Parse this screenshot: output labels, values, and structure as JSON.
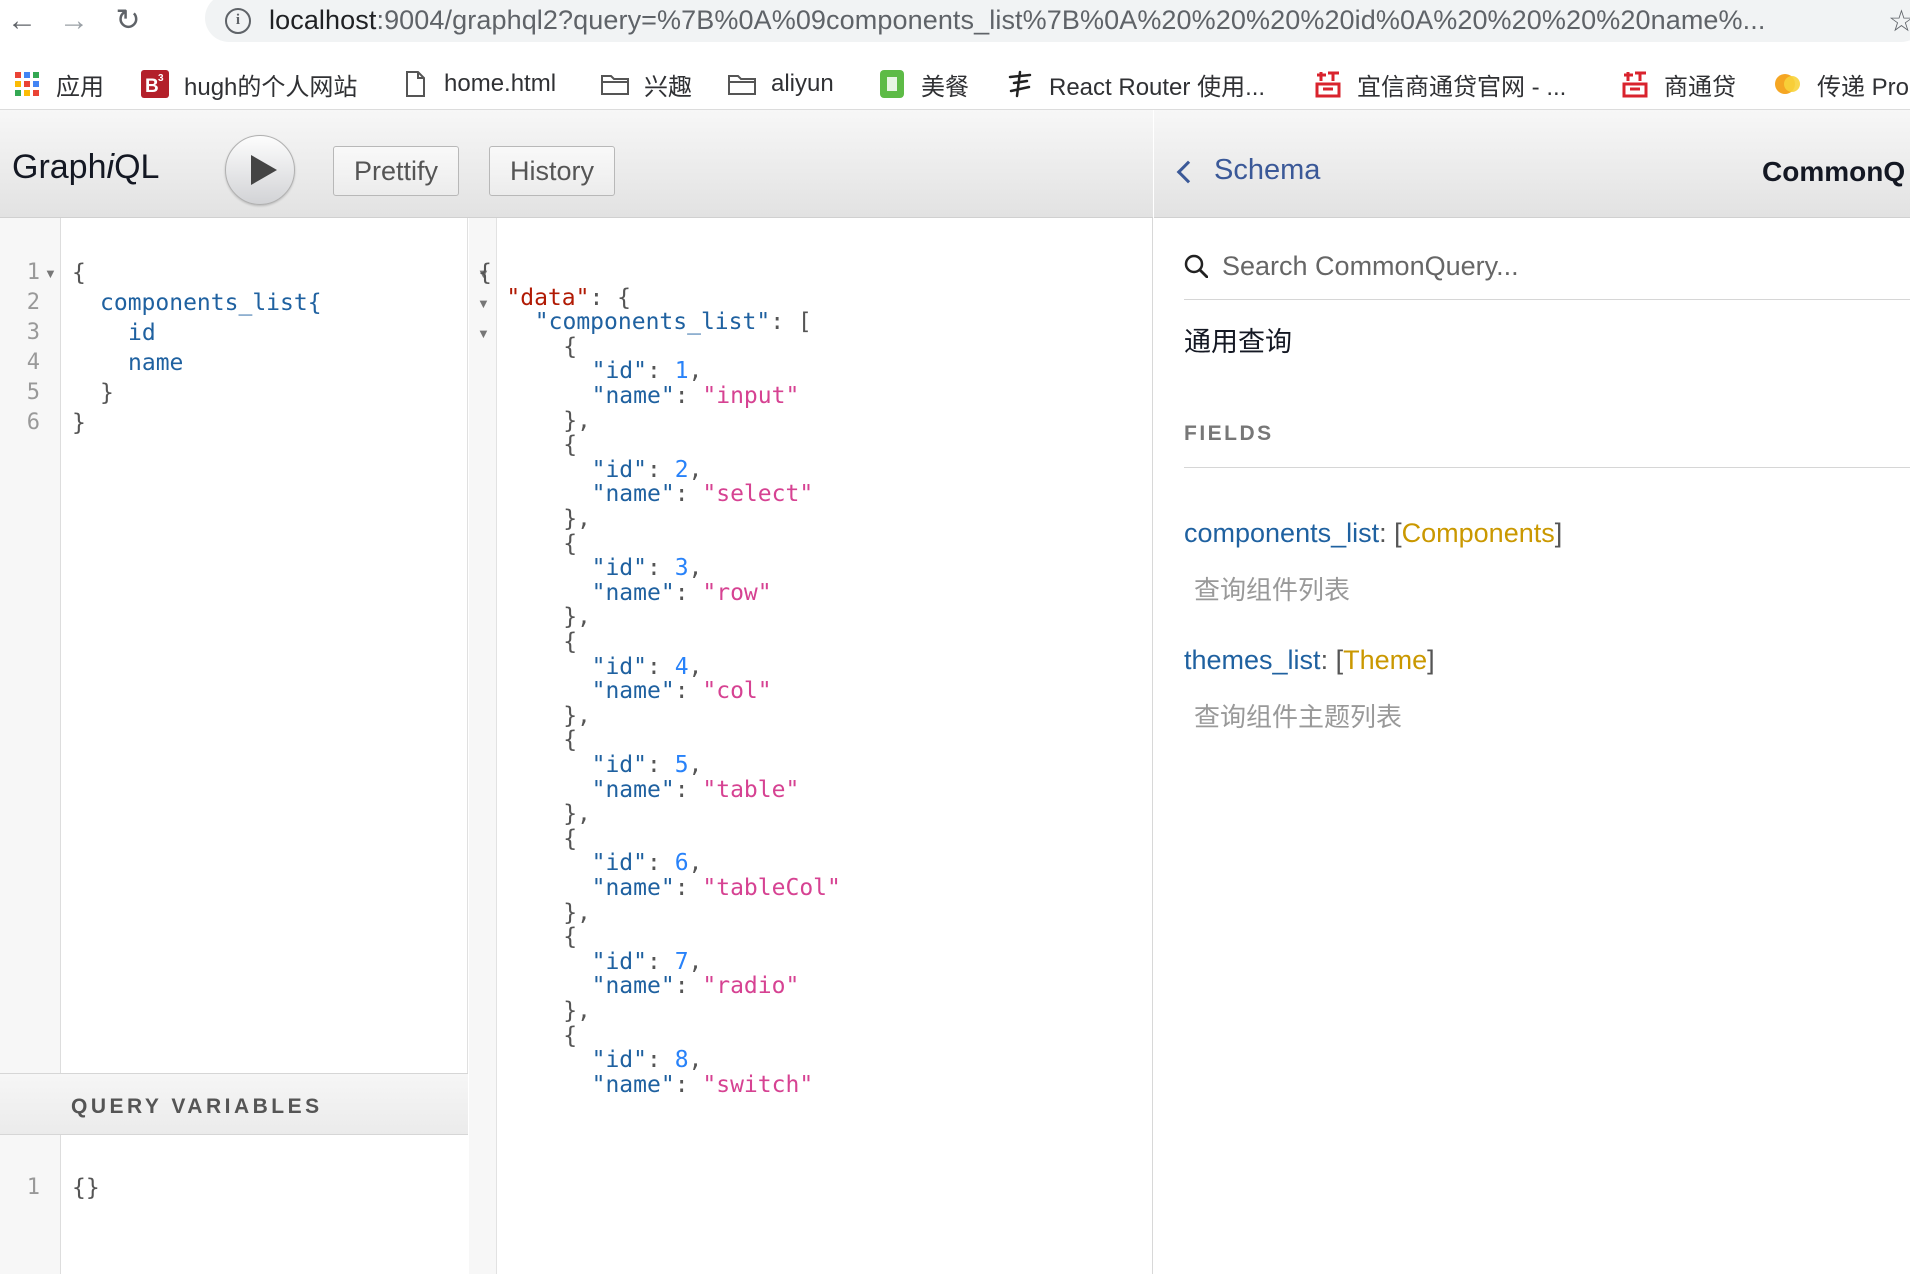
{
  "browser": {
    "url_host": "localhost",
    "url_rest": ":9004/graphql2?query=%7B%0A%09components_list%7B%0A%20%20%20%20id%0A%20%20%20%20name%...",
    "bookmarks": [
      {
        "label": "应用",
        "icon": "apps-grid-icon"
      },
      {
        "label": "hugh的个人网站",
        "icon": "b3-icon"
      },
      {
        "label": "home.html",
        "icon": "file-icon"
      },
      {
        "label": "兴趣",
        "icon": "folder-icon"
      },
      {
        "label": "aliyun",
        "icon": "folder-icon"
      },
      {
        "label": "美餐",
        "icon": "meican-icon"
      },
      {
        "label": "React Router 使用...",
        "icon": "calligraphy-icon"
      },
      {
        "label": "宜信商通贷官网 - ...",
        "icon": "dai-icon"
      },
      {
        "label": "商通贷",
        "icon": "dai-icon"
      },
      {
        "label": "传递 Pro",
        "icon": "chuandi-icon"
      }
    ]
  },
  "toolbar": {
    "title_a": "Graph",
    "title_i": "i",
    "title_b": "QL",
    "prettify_label": "Prettify",
    "history_label": "History"
  },
  "query_editor": {
    "line_numbers": [
      "1",
      "2",
      "3",
      "4",
      "5",
      "6"
    ],
    "lines": [
      "{",
      "components_list{",
      "id",
      "name",
      "}",
      "}"
    ]
  },
  "variables": {
    "title": "QUERY VARIABLES",
    "line_number": "1",
    "content": "{}"
  },
  "result": [
    {
      "id": 1,
      "name": "input"
    },
    {
      "id": 2,
      "name": "select"
    },
    {
      "id": 3,
      "name": "row"
    },
    {
      "id": 4,
      "name": "col"
    },
    {
      "id": 5,
      "name": "table"
    },
    {
      "id": 6,
      "name": "tableCol"
    },
    {
      "id": 7,
      "name": "radio"
    },
    {
      "id": 8,
      "name": "switch"
    }
  ],
  "result_keys": {
    "data": "\"data\"",
    "list": "\"components_list\"",
    "id": "\"id\"",
    "name": "\"name\""
  },
  "docs": {
    "back_label": "Schema",
    "title": "CommonQ",
    "search_placeholder": "Search CommonQuery...",
    "description": "通用查询",
    "fields_heading": "FIELDS",
    "fields": [
      {
        "name": "components_list",
        "type": "Components",
        "desc": "查询组件列表"
      },
      {
        "name": "themes_list",
        "type": "Theme",
        "desc": "查询组件主题列表"
      }
    ]
  }
}
